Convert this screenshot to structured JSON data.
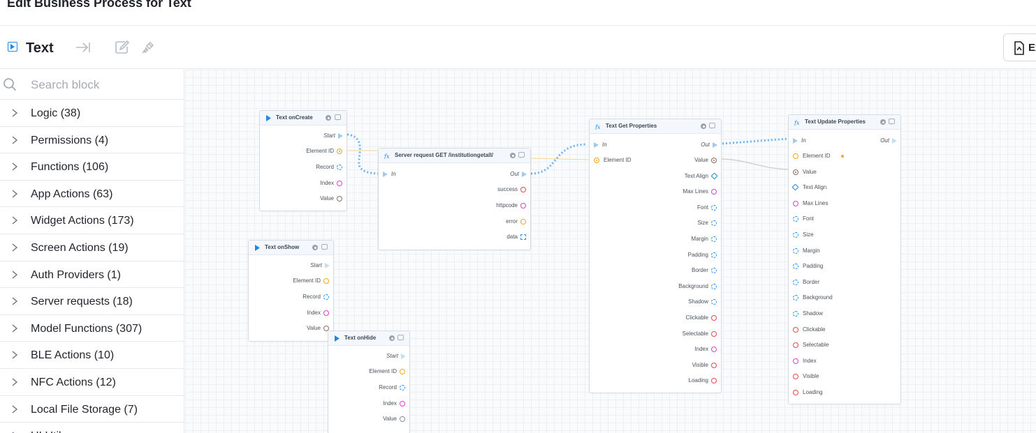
{
  "page_title": "Edit Business Process for Text",
  "toolbar": {
    "title": "Text",
    "export_label": "Ex"
  },
  "sidebar": {
    "search_placeholder": "Search block",
    "categories": [
      "Logic (38)",
      "Permissions (4)",
      "Functions (106)",
      "App Actions (63)",
      "Widget Actions (173)",
      "Screen Actions (19)",
      "Auth Providers (1)",
      "Server requests (18)",
      "Model Functions (307)",
      "BLE Actions (10)",
      "NFC Actions (12)",
      "Local File Storage (7)",
      "UI Utils"
    ]
  },
  "colors": {
    "accent": "#1e88e5",
    "orange": "#f5a623",
    "magenta": "#e040c8",
    "red": "#e5484d",
    "blue_port": "#1e88e5",
    "grey": "#8a8f96",
    "brown": "#8d6e63"
  },
  "nodes": {
    "oncreate": {
      "title": "Text onCreate",
      "ports": [
        "Start",
        "Element ID",
        "Record",
        "Index",
        "Value"
      ]
    },
    "server": {
      "title": "Server request GET /institutiongetall/",
      "in": "In",
      "out": "Out",
      "ports": [
        "success",
        "httpcode",
        "error",
        "data"
      ]
    },
    "onshow": {
      "title": "Text onShow",
      "ports": [
        "Start",
        "Element ID",
        "Record",
        "Index",
        "Value"
      ]
    },
    "onhide": {
      "title": "Text onHide",
      "ports": [
        "Start",
        "Element ID",
        "Record",
        "Index",
        "Value"
      ]
    },
    "getprops": {
      "title": "Text Get Properties",
      "in": "In",
      "out": "Out",
      "input": "Element ID",
      "ports": [
        "Value",
        "Text Align",
        "Max Lines",
        "Font",
        "Size",
        "Margin",
        "Padding",
        "Border",
        "Background",
        "Shadow",
        "Clickable",
        "Selectable",
        "Index",
        "Visible",
        "Loading"
      ]
    },
    "updateprops": {
      "title": "Text Update Properties",
      "in": "In",
      "out": "Out",
      "ports": [
        "Element ID",
        "Value",
        "Text Align",
        "Max Lines",
        "Font",
        "Size",
        "Margin",
        "Padding",
        "Border",
        "Background",
        "Shadow",
        "Clickable",
        "Selectable",
        "Index",
        "Visible",
        "Loading"
      ]
    }
  }
}
